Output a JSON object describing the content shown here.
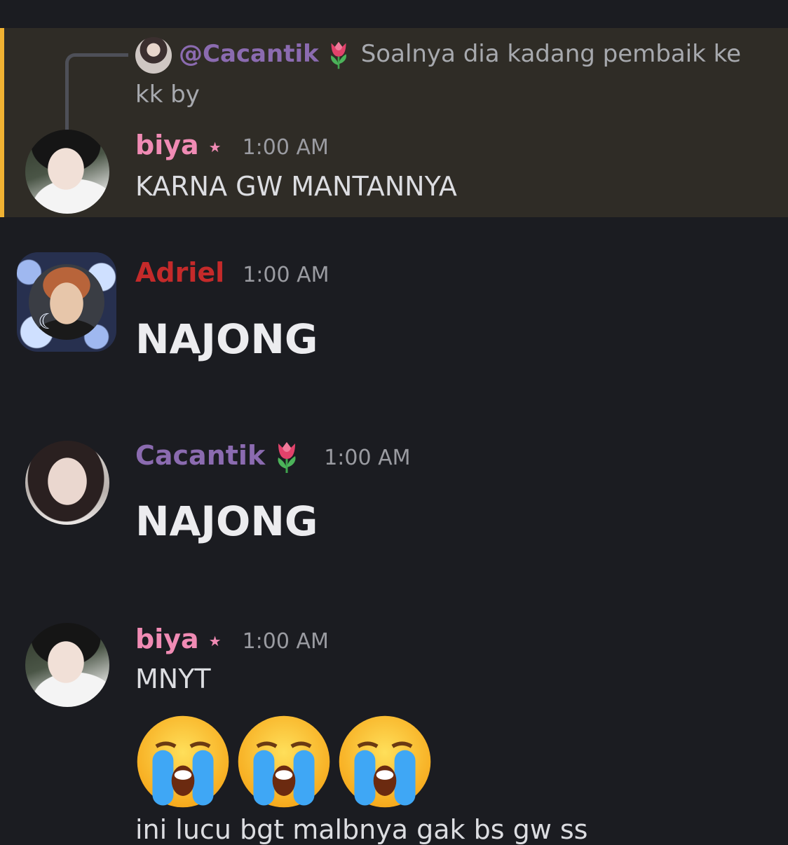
{
  "reply": {
    "mention": "@Cacantik",
    "text": "Soalnya dia kadang pembaik ke kk by"
  },
  "messages": [
    {
      "username": "biya",
      "badge": "★",
      "timestamp": "1:00 AM",
      "text": "KARNA GW MANTANNYA"
    },
    {
      "username": "Adriel",
      "timestamp": "1:00 AM",
      "text": "NAJONG"
    },
    {
      "username": "Cacantik",
      "timestamp": "1:00 AM",
      "text": "NAJONG"
    },
    {
      "username": "biya",
      "badge": "★",
      "timestamp": "1:00 AM",
      "text": "MNYT",
      "emojis": [
        "loudly-crying-face",
        "loudly-crying-face",
        "loudly-crying-face"
      ],
      "next_line": "ini lucu bgt malbnya gak bs gw ss"
    }
  ],
  "colors": {
    "background": "#1b1c21",
    "mention_highlight": "#2f2c26",
    "mention_bar": "#f0b232",
    "biya": "#f08bb4",
    "adriel": "#c42a2a",
    "cacantik": "#8b6bb0",
    "timestamp": "#9a9ba1"
  }
}
